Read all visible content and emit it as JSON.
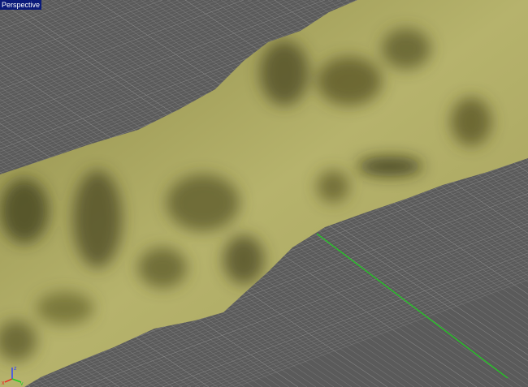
{
  "viewport": {
    "label": "Perspective",
    "grid_color": "#8a8a8a",
    "background_color": "#5a5a5a",
    "terrain_color": "#b8b56a",
    "axis_line_color": "#22cc22"
  },
  "axis_widget": {
    "x": "x",
    "y": "y",
    "z": "z"
  }
}
